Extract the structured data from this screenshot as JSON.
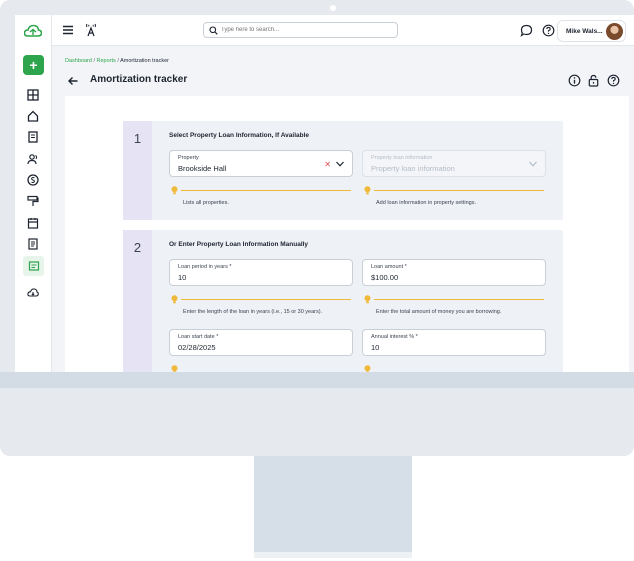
{
  "topbar": {
    "search_placeholder": "Type here to search...",
    "user_name": "Mike Wals..."
  },
  "breadcrumb": {
    "items": [
      "Dashboard",
      "Reports",
      "Amortization tracker"
    ],
    "separator": "/"
  },
  "page": {
    "title": "Amortization tracker"
  },
  "sections": [
    {
      "number": "1",
      "title": "Select Property Loan Information, If Available",
      "fields": [
        {
          "label": "Property",
          "value": "Brookside Hall",
          "hint": "Lists all properties."
        },
        {
          "label": "Property loan information",
          "value": "Property loan information",
          "hint": "Add loan information in property settings."
        }
      ]
    },
    {
      "number": "2",
      "title": "Or Enter Property Loan Information Manually",
      "fields": [
        {
          "label": "Loan period in years *",
          "value": "10",
          "hint": "Enter the length of the loan in years (i.e., 15 or 30 years)."
        },
        {
          "label": "Loan amount *",
          "value": "$100.00",
          "hint": "Enter the total amount of money you are borrowing."
        },
        {
          "label": "Loan start date *",
          "value": "02/28/2025",
          "hint": ""
        },
        {
          "label": "Annual interest % *",
          "value": "10",
          "hint": ""
        }
      ]
    }
  ],
  "colors": {
    "accent": "#2da54c",
    "hint_line": "#f0b93a",
    "section_bg": "#eef1f6",
    "number_col_bg": "#e6e3f4"
  }
}
